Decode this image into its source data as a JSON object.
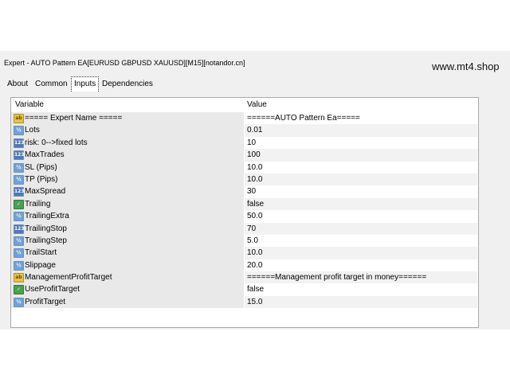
{
  "window": {
    "title": "Expert - AUTO Pattern EA[EURUSD GBPUSD XAUUSD][M15][notandor.cn]",
    "watermark": "www.mt4.shop"
  },
  "tabs": [
    {
      "label": "About",
      "active": false
    },
    {
      "label": "Common",
      "active": false
    },
    {
      "label": "Inputs",
      "active": true
    },
    {
      "label": "Dependencies",
      "active": false
    }
  ],
  "table": {
    "headers": {
      "variable": "Variable",
      "value": "Value"
    },
    "rows": [
      {
        "icon": "ab",
        "name": "===== Expert Name =====",
        "value": "======AUTO Pattern Ea====="
      },
      {
        "icon": "dbl",
        "name": "Lots",
        "value": "0.01"
      },
      {
        "icon": "int",
        "name": "risk: 0-->fixed lots",
        "value": "10"
      },
      {
        "icon": "int",
        "name": "MaxTrades",
        "value": "100"
      },
      {
        "icon": "dbl",
        "name": "SL (Pips)",
        "value": "10.0"
      },
      {
        "icon": "dbl",
        "name": "TP (Pips)",
        "value": "10.0"
      },
      {
        "icon": "int",
        "name": "MaxSpread",
        "value": "30"
      },
      {
        "icon": "bool",
        "name": "Trailing",
        "value": "false"
      },
      {
        "icon": "dbl",
        "name": "TrailingExtra",
        "value": "50.0"
      },
      {
        "icon": "int",
        "name": "TrailingStop",
        "value": "70"
      },
      {
        "icon": "dbl",
        "name": "TrailingStep",
        "value": "5.0"
      },
      {
        "icon": "dbl",
        "name": "TrailStart",
        "value": "10.0"
      },
      {
        "icon": "dbl",
        "name": "Slippage",
        "value": "20.0"
      },
      {
        "icon": "ab",
        "name": "ManagementProfitTarget",
        "value": "======Management profit target in money======"
      },
      {
        "icon": "bool",
        "name": "UseProfitTarget",
        "value": "false"
      },
      {
        "icon": "dbl",
        "name": "ProfitTarget",
        "value": "15.0"
      }
    ]
  },
  "icons": {
    "ab": {
      "name": "string-type-icon",
      "glyph": "ab"
    },
    "int": {
      "name": "integer-type-icon",
      "glyph": "123"
    },
    "dbl": {
      "name": "double-type-icon",
      "glyph": "½"
    },
    "bool": {
      "name": "boolean-type-icon",
      "glyph": "✓"
    }
  }
}
